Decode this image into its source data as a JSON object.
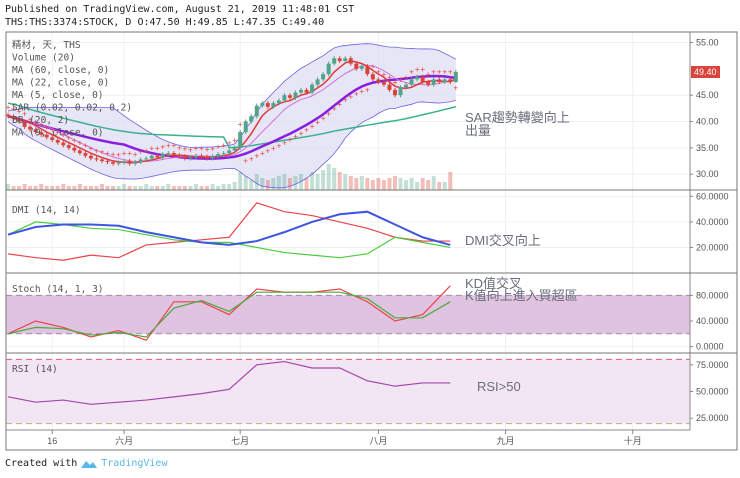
{
  "header": {
    "published": "Published on TradingView.com, August 21, 2019 11:48:01 CST",
    "symbol_line": "THS:THS:3374:STOCK, D O:47.50 H:49.85 L:47.35 C:49.40"
  },
  "footer": {
    "created_with": "Created with",
    "brand": "TradingView"
  },
  "colors": {
    "up": "#53a38a",
    "down": "#d8443a",
    "ma60": "#3bb08f",
    "ma22": "#8a1ee0",
    "ma5": "#e0393a",
    "ma9": "#d070d8",
    "sar": "#e8454a",
    "bb": "#6a63e0",
    "bb_fill": "#dcdcf2",
    "dmi_plus": "#e8454a",
    "dmi_minus": "#4ccc3c",
    "adx": "#3d55e0",
    "stoch_k": "#e8454a",
    "stoch_d": "#4caa3c",
    "stoch_band": "#d9b8dc",
    "rsi": "#a347ab",
    "rsi_band": "#f1e2f2",
    "last_price_badge": "#d8443a"
  },
  "chart_data": [
    {
      "type": "candlestick",
      "pane": "price",
      "legend": [
        "精材, 天, THS",
        "Volume (20)",
        "MA (60, close, 0)",
        "MA (22, close, 0)",
        "MA (5, close, 0)",
        "SAR (0.02, 0.02, 0.2)",
        "BB (20, 2)",
        "MA (9, close, 0)"
      ],
      "yticks": [
        "55.00",
        "45.00",
        "40.00",
        "35.00",
        "30.00"
      ],
      "ylim": [
        27,
        57
      ],
      "last_price": "49.40",
      "xticks": [
        {
          "label": "16",
          "bar": 8
        },
        {
          "label": "六月",
          "bar": 21
        },
        {
          "label": "七月",
          "bar": 42
        },
        {
          "label": "八月",
          "bar": 67
        },
        {
          "label": "九月",
          "bar": 90
        },
        {
          "label": "十月",
          "bar": 113
        }
      ],
      "xbars": 123,
      "close": [
        41,
        40.5,
        40,
        39,
        38.5,
        38,
        37.5,
        37,
        36.5,
        36,
        35.5,
        35,
        34.5,
        34,
        33.5,
        33,
        32.8,
        32.5,
        32.3,
        32,
        32.2,
        32.5,
        32,
        32.3,
        32.8,
        33,
        33.5,
        33.2,
        33.8,
        34,
        33.6,
        33.4,
        33,
        33.2,
        33.5,
        33.3,
        33,
        33.4,
        33.8,
        34,
        34.5,
        35,
        38,
        40,
        41,
        43,
        43.5,
        42.8,
        43.5,
        44,
        45,
        44.5,
        45.5,
        46,
        45.5,
        47,
        48,
        49,
        51,
        52,
        51.5,
        52,
        51,
        50,
        50.5,
        49,
        48,
        47.5,
        47,
        46,
        45,
        46.5,
        47,
        48,
        48.5,
        47.5,
        47,
        48,
        47.5,
        48,
        47.5,
        49.4
      ],
      "last_bar": {
        "open": 47.5,
        "high": 49.85,
        "low": 47.35,
        "close": 49.4
      },
      "volume": [
        3,
        2,
        2,
        3,
        2,
        2,
        3,
        2,
        2,
        2,
        3,
        2,
        2,
        3,
        2,
        2,
        2,
        3,
        2,
        2,
        2,
        3,
        2,
        2,
        2,
        3,
        2,
        2,
        2,
        3,
        2,
        2,
        2,
        2,
        3,
        2,
        2,
        3,
        2,
        3,
        3,
        4,
        9,
        7,
        5,
        8,
        6,
        5,
        6,
        7,
        8,
        6,
        7,
        8,
        6,
        9,
        8,
        10,
        13,
        11,
        9,
        8,
        7,
        6,
        7,
        6,
        5,
        6,
        5,
        6,
        7,
        6,
        5,
        6,
        4,
        6,
        5,
        7,
        4,
        4,
        9
      ]
    },
    {
      "type": "line",
      "pane": "dmi",
      "legend": "DMI (14, 14)",
      "yticks": [
        "60.0000",
        "40.0000",
        "20.0000"
      ],
      "ylim": [
        0,
        65
      ],
      "series": [
        {
          "color_key": "dmi_plus",
          "values": [
            15,
            12,
            10,
            14,
            12,
            22,
            24,
            26,
            28,
            55,
            48,
            45,
            40,
            35,
            28,
            25,
            25
          ]
        },
        {
          "color_key": "dmi_minus",
          "values": [
            30,
            40,
            38,
            35,
            34,
            30,
            26,
            24,
            24,
            20,
            16,
            14,
            12,
            15,
            28,
            24,
            20
          ]
        },
        {
          "color_key": "adx",
          "values": [
            30,
            36,
            38,
            38,
            37,
            32,
            28,
            24,
            22,
            25,
            32,
            40,
            46,
            48,
            38,
            28,
            22
          ]
        }
      ],
      "annotation": "DMI交叉向上"
    },
    {
      "type": "line",
      "pane": "stoch",
      "legend": "Stoch (14, 1, 3)",
      "yticks": [
        "80.0000",
        "40.0000",
        "0.0000"
      ],
      "ylim": [
        -10,
        115
      ],
      "band": [
        20,
        80
      ],
      "series": [
        {
          "color_key": "stoch_k",
          "values": [
            20,
            40,
            30,
            15,
            25,
            10,
            70,
            70,
            50,
            90,
            85,
            85,
            90,
            70,
            40,
            50,
            95
          ]
        },
        {
          "color_key": "stoch_d",
          "values": [
            20,
            30,
            28,
            18,
            22,
            15,
            60,
            72,
            55,
            85,
            85,
            85,
            85,
            75,
            45,
            45,
            70
          ]
        }
      ],
      "annotation": [
        "KD值交叉",
        "K值向上進入買超區"
      ]
    },
    {
      "type": "line",
      "pane": "rsi",
      "legend": "RSI (14)",
      "yticks": [
        "75.0000",
        "50.0000",
        "25.0000"
      ],
      "ylim": [
        14,
        86
      ],
      "band": [
        20,
        80
      ],
      "series": [
        {
          "color_key": "rsi",
          "values": [
            45,
            40,
            42,
            38,
            40,
            42,
            45,
            48,
            52,
            75,
            78,
            72,
            72,
            60,
            55,
            58,
            58
          ]
        }
      ],
      "annotation": "RSI>50"
    }
  ],
  "annotations": {
    "sar": "SAR趨勢轉變向上",
    "volume": "出量"
  }
}
